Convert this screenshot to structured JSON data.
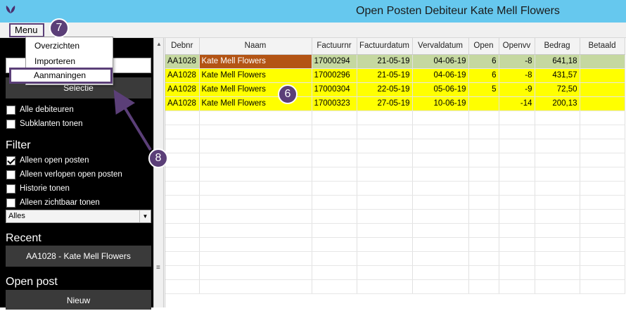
{
  "window": {
    "title": "Open Posten Debiteur Kate Mell Flowers",
    "title_bar_color": "#66c8ee"
  },
  "menubar": {
    "menu_label": "Menu"
  },
  "menu_dropdown": {
    "items": [
      "Overzichten",
      "Importeren",
      "Aanmaningen"
    ]
  },
  "sidebar": {
    "selectie_button": "Selectie",
    "checkboxes_top": [
      {
        "label": "Alle debiteuren",
        "checked": false
      },
      {
        "label": "Subklanten tonen",
        "checked": false
      }
    ],
    "filter_heading": "Filter",
    "filter_checkboxes": [
      {
        "label": "Alleen open posten",
        "checked": true
      },
      {
        "label": "Alleen verlopen open posten",
        "checked": false
      },
      {
        "label": "Historie tonen",
        "checked": false
      },
      {
        "label": "Alleen zichtbaar tonen",
        "checked": false
      }
    ],
    "select_value": "Alles",
    "recent_heading": "Recent",
    "recent_item": "AA1028 - Kate Mell Flowers",
    "open_post_heading": "Open post",
    "nieuw_button": "Nieuw"
  },
  "table": {
    "columns": [
      "Debnr",
      "Naam",
      "Factuurnr",
      "Factuurdatum",
      "Vervaldatum",
      "Open",
      "Openvv",
      "Bedrag",
      "Betaald"
    ],
    "rows": [
      [
        "AA1028",
        "Kate Mell Flowers",
        "17000294",
        "21-05-19",
        "04-06-19",
        "6",
        "-8",
        "641,18",
        ""
      ],
      [
        "AA1028",
        "Kate Mell Flowers",
        "17000296",
        "21-05-19",
        "04-06-19",
        "6",
        "-8",
        "431,57",
        ""
      ],
      [
        "AA1028",
        "Kate Mell Flowers",
        "17000304",
        "22-05-19",
        "05-06-19",
        "5",
        "-9",
        "72,50",
        ""
      ],
      [
        "AA1028",
        "Kate Mell Flowers",
        "17000323",
        "27-05-19",
        "10-06-19",
        "",
        "-14",
        "200,13",
        ""
      ]
    ],
    "selected_row_color": "#c5d8a0",
    "selected_name_color": "#b35414",
    "highlight_color": "#ffff00"
  },
  "annotations": {
    "badge_menu": "7",
    "badge_rows": "6",
    "badge_arrow": "8",
    "color": "#5b3f78"
  }
}
